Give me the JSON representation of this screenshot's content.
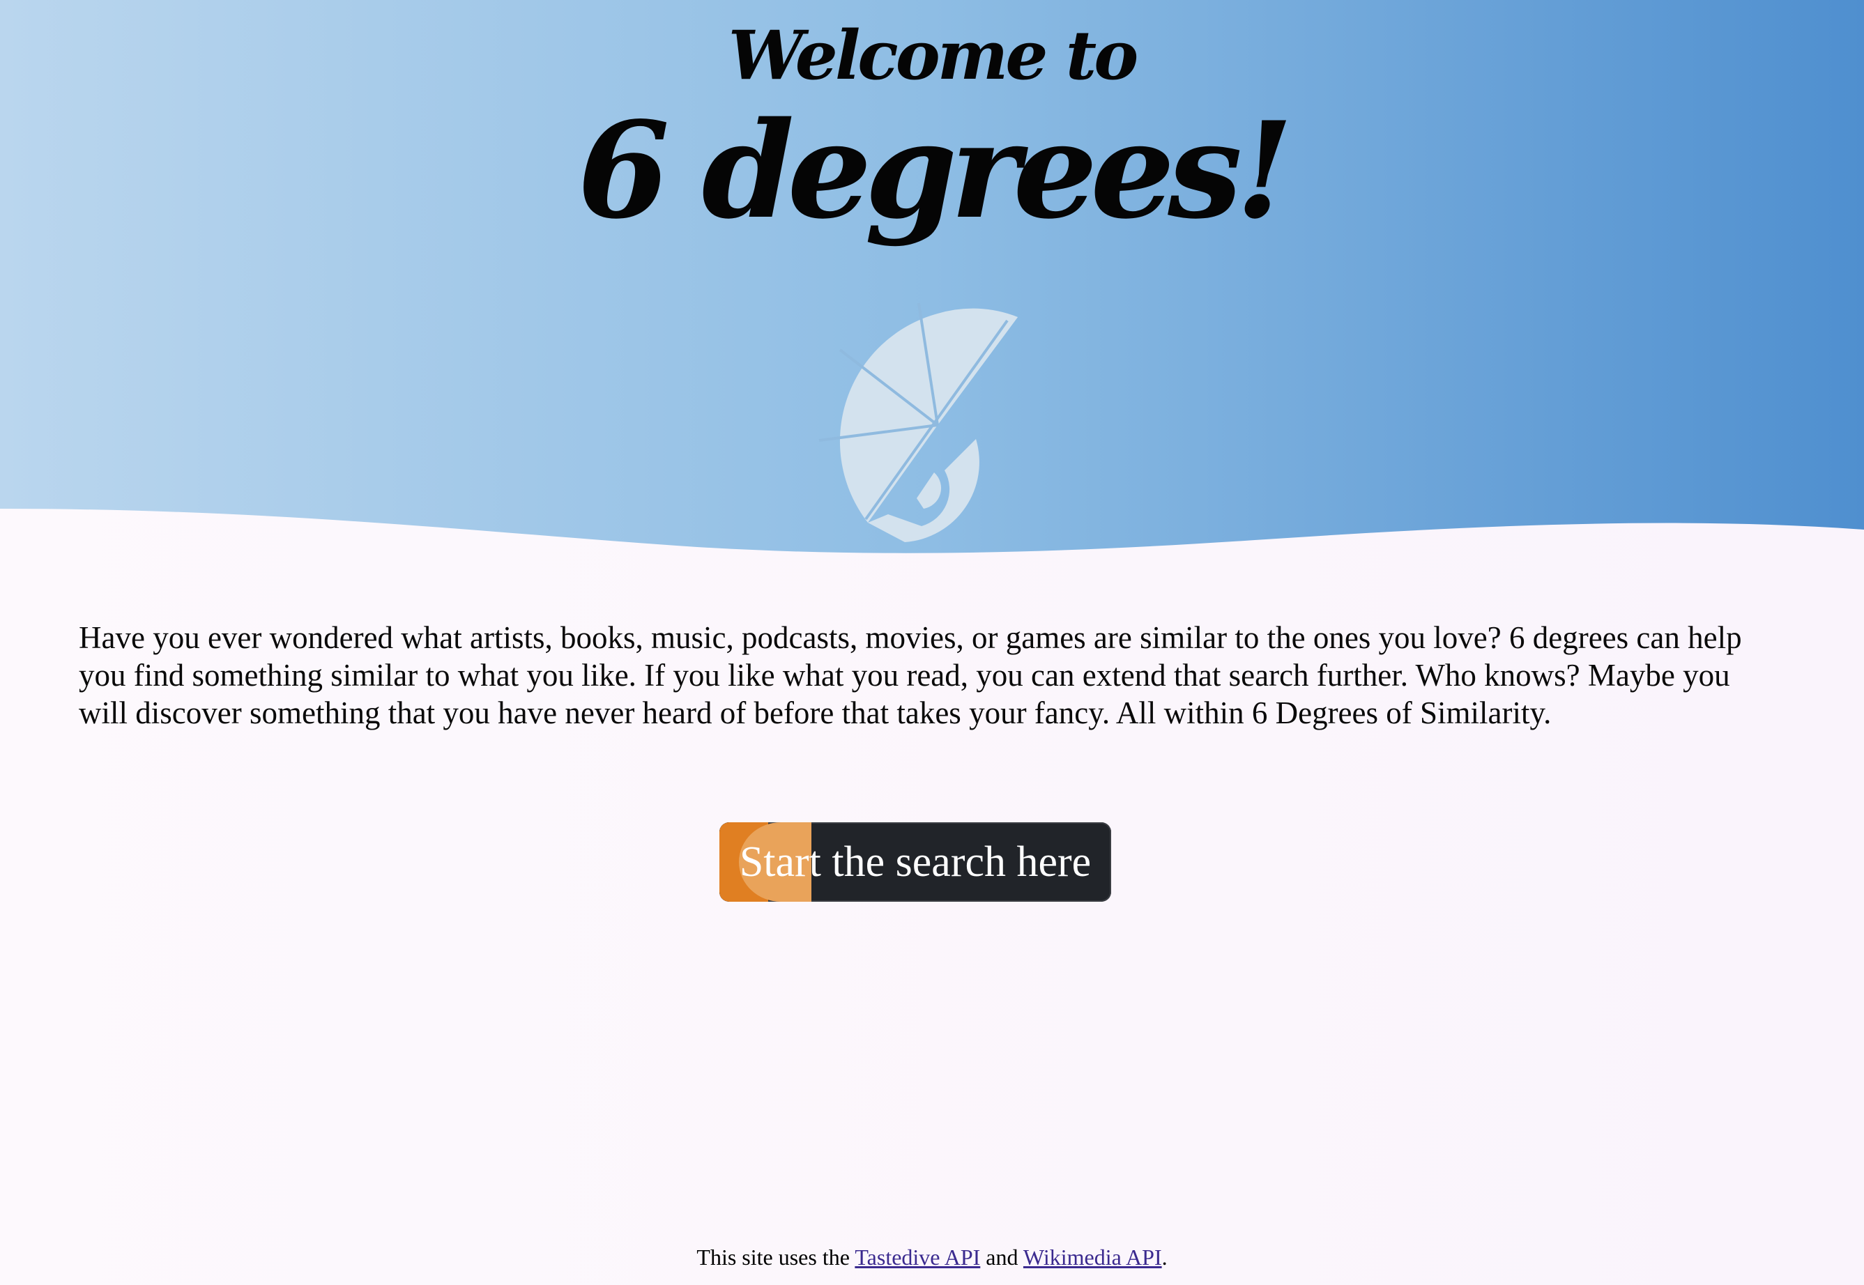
{
  "header": {
    "welcome": "Welcome to",
    "title": "6 degrees!"
  },
  "logo": {
    "icon": "six-degrees-logo-icon"
  },
  "intro": {
    "text": "Have you ever wondered what artists, books, music, podcasts, movies, or games are similar to the ones you love? 6 degrees can help you find something similar to what you like. If you like what you read, you can extend that search further. Who knows? Maybe you will discover something that you have never heard of before that takes your fancy. All within 6 Degrees of Similarity."
  },
  "cta": {
    "label": "Start the search here"
  },
  "footer": {
    "prefix": "This site uses the",
    "link1": "Tastedive API",
    "middle": "and",
    "link2": "Wikimedia API",
    "suffix": "."
  },
  "colors": {
    "hero_gradient_start": "#b9d5ee",
    "hero_gradient_end": "#4f90cf",
    "button_bg": "#212429",
    "button_accent_dark": "#e07f22",
    "button_accent_light": "#e9a35a",
    "link": "#3b2a8f"
  }
}
